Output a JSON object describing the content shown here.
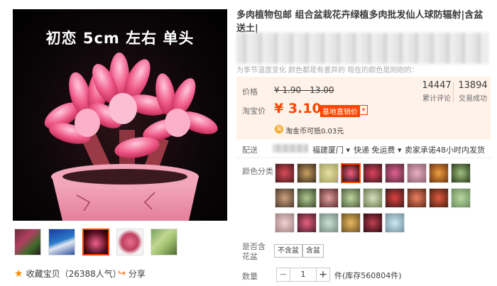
{
  "main_image": {
    "caption": "初恋 5cm 左右 单头"
  },
  "actions": {
    "favorite": "收藏宝贝（26388人气）",
    "share": "分享"
  },
  "product": {
    "title": "多肉植物包邮 组合盆栽花卉绿植多肉批发仙人球防辐射|含盆送土|",
    "notice": "为季节温度变化 颜色都是有差异的 现在的颜色是刚刚的："
  },
  "price": {
    "label": "价格",
    "original": "¥ 1.90 - 13.00",
    "taobao_label": "淘宝价",
    "taobao_price": "¥ 3.10",
    "badge": "基地直销价",
    "badge_arrow": "▾",
    "coin_icon": "coin-icon",
    "coin_text": "淘金币可抵0.03元"
  },
  "stats": [
    {
      "value": "14447",
      "label": "累计评论"
    },
    {
      "value": "13894",
      "label": "交易成功"
    }
  ],
  "delivery": {
    "label": "配送",
    "origin": "福建厦门",
    "method": "快递 免运费",
    "promise": "卖家承诺48小时内发货"
  },
  "color": {
    "label": "颜色分类"
  },
  "pot": {
    "label": "是否含花盆",
    "options": [
      "不含盆",
      "含盆"
    ]
  },
  "quantity": {
    "label": "数量",
    "value": "1",
    "minus": "−",
    "plus": "+",
    "unit": "件(库存560804件)"
  },
  "colors": {
    "accent": "#ff4400",
    "panel": "#fff2e8",
    "badge": "#ff4400"
  }
}
